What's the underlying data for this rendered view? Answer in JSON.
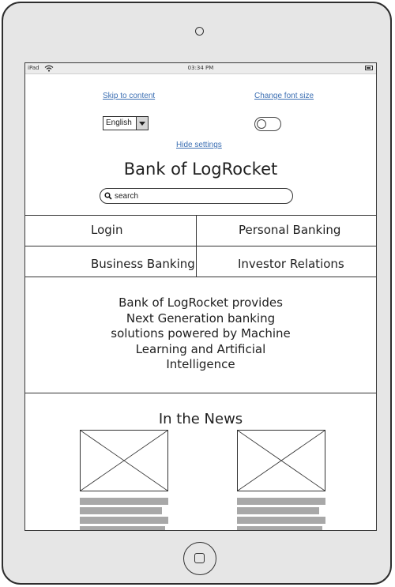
{
  "status_bar": {
    "carrier": "iPad",
    "time": "03:34 PM"
  },
  "settings": {
    "skip_link": "Skip to content",
    "font_size_link": "Change font size",
    "language_selected": "English",
    "hide_settings_link": "Hide settings"
  },
  "header": {
    "title": "Bank of LogRocket",
    "search_placeholder": "search"
  },
  "nav": {
    "items": [
      {
        "label": "Login"
      },
      {
        "label": "Personal Banking"
      },
      {
        "label": "Business Banking"
      },
      {
        "label": "Investor Relations"
      }
    ]
  },
  "hero": {
    "line1": "Bank of LogRocket provides",
    "line2": "Next Generation banking",
    "line3": "solutions powered by Machine",
    "line4": "Learning and Artificial",
    "line5": "Intelligence"
  },
  "news": {
    "title": "In the News",
    "cards": [
      {
        "image": "placeholder-image"
      },
      {
        "image": "placeholder-image"
      }
    ]
  },
  "icons": {
    "wifi": "wifi-icon",
    "battery": "battery-icon",
    "search": "search-icon",
    "camera": "camera-icon",
    "home": "home-button-icon"
  }
}
